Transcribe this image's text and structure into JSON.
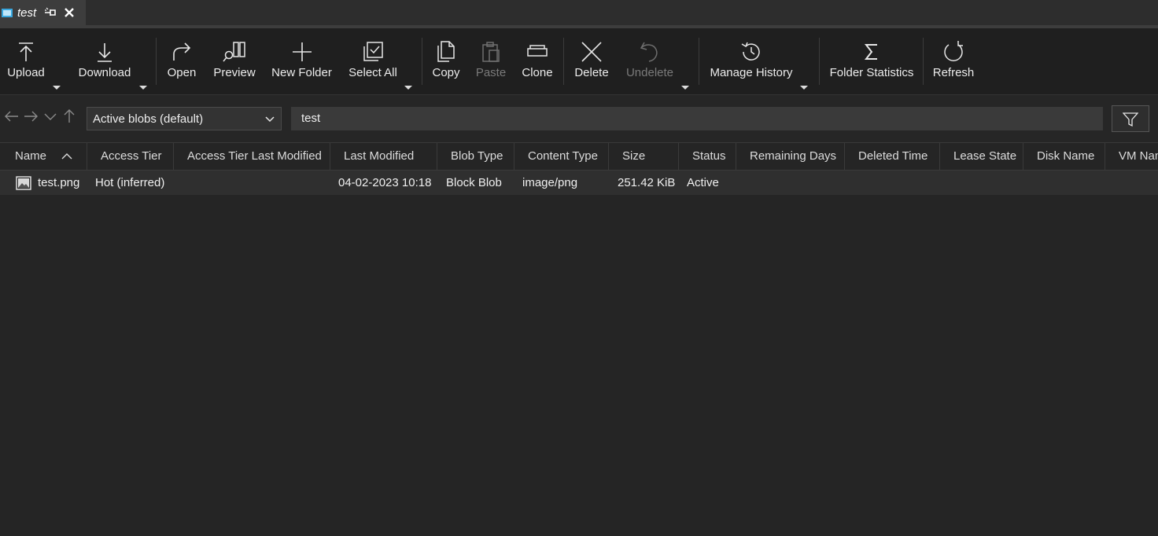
{
  "tab": {
    "title": "test",
    "icons": [
      "folder-icon",
      "pin-icon",
      "close-icon"
    ]
  },
  "toolbar": {
    "upload": "Upload",
    "download": "Download",
    "open": "Open",
    "preview": "Preview",
    "new_folder": "New Folder",
    "select_all": "Select All",
    "copy": "Copy",
    "paste": "Paste",
    "clone": "Clone",
    "delete": "Delete",
    "undelete": "Undelete",
    "manage_history": "Manage History",
    "folder_statistics": "Folder Statistics",
    "refresh": "Refresh"
  },
  "address": {
    "view_mode": "Active blobs (default)",
    "path": "test"
  },
  "columns": {
    "name": "Name",
    "access_tier": "Access Tier",
    "access_tier_last_modified": "Access Tier Last Modified",
    "last_modified": "Last Modified",
    "blob_type": "Blob Type",
    "content_type": "Content Type",
    "size": "Size",
    "status": "Status",
    "remaining_days": "Remaining Days",
    "deleted_time": "Deleted Time",
    "lease_state": "Lease State",
    "disk_name": "Disk Name",
    "vm_name": "VM Name"
  },
  "rows": [
    {
      "name": "test.png",
      "access_tier": "Hot (inferred)",
      "last_modified": "04-02-2023 10:18",
      "blob_type": "Block Blob",
      "content_type": "image/png",
      "size": "251.42 KiB",
      "status": "Active"
    }
  ],
  "colors": {
    "background": "#252525",
    "toolbar": "#1f1f1f",
    "tab_accent": "#3aa8e0",
    "disabled_text": "#7a7a7a"
  }
}
